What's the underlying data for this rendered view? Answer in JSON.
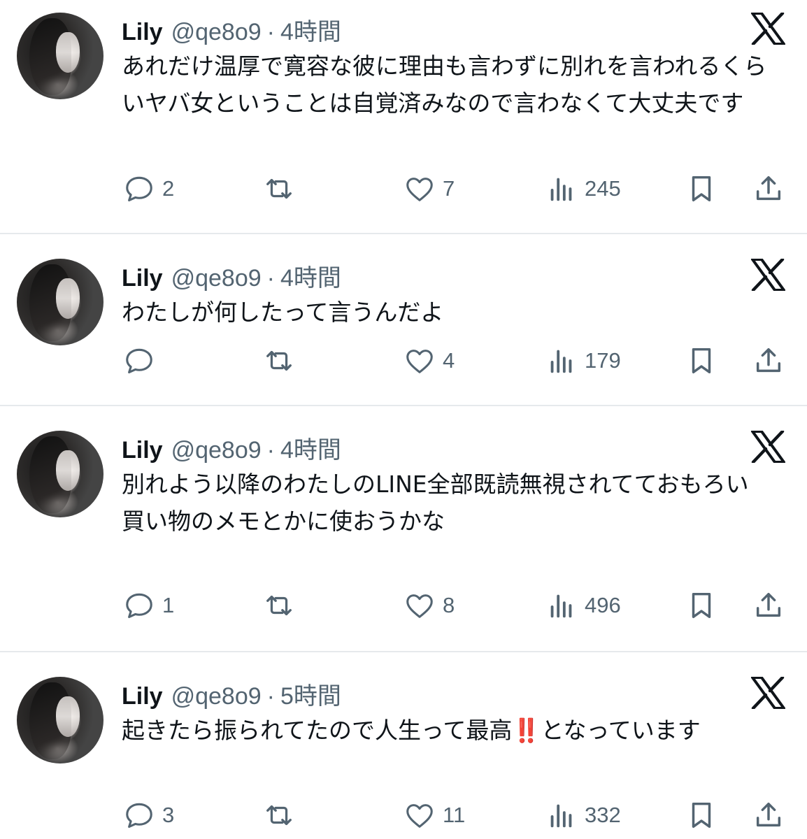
{
  "colors": {
    "text": "#0f1419",
    "secondary": "#536471",
    "divider": "#e6e9ec",
    "icon": "#536471"
  },
  "icons": [
    "reply-icon",
    "retweet-icon",
    "like-icon",
    "views-icon",
    "bookmark-icon",
    "share-icon",
    "x-logo-icon"
  ],
  "tweets": [
    {
      "name": "Lily",
      "handle": "@qe8o9",
      "sep": "·",
      "time": "4時間",
      "text": "あれだけ温厚で寛容な彼に理由も言わずに別れを言われるくらいヤバ女ということは自覚済みなので言わなくて大丈夫です",
      "replies": "2",
      "retweets": "",
      "likes": "7",
      "views": "245"
    },
    {
      "name": "Lily",
      "handle": "@qe8o9",
      "sep": "·",
      "time": "4時間",
      "text": "わたしが何したって言うんだよ",
      "replies": "",
      "retweets": "",
      "likes": "4",
      "views": "179"
    },
    {
      "name": "Lily",
      "handle": "@qe8o9",
      "sep": "·",
      "time": "4時間",
      "text": "別れよう以降のわたしのLINE全部既読無視されてておもろい\n買い物のメモとかに使おうかな",
      "replies": "1",
      "retweets": "",
      "likes": "8",
      "views": "496"
    },
    {
      "name": "Lily",
      "handle": "@qe8o9",
      "sep": "·",
      "time": "5時間",
      "text": "起きたら振られてたので人生って最高‼️となっています",
      "replies": "3",
      "retweets": "",
      "likes": "11",
      "views": "332"
    }
  ]
}
